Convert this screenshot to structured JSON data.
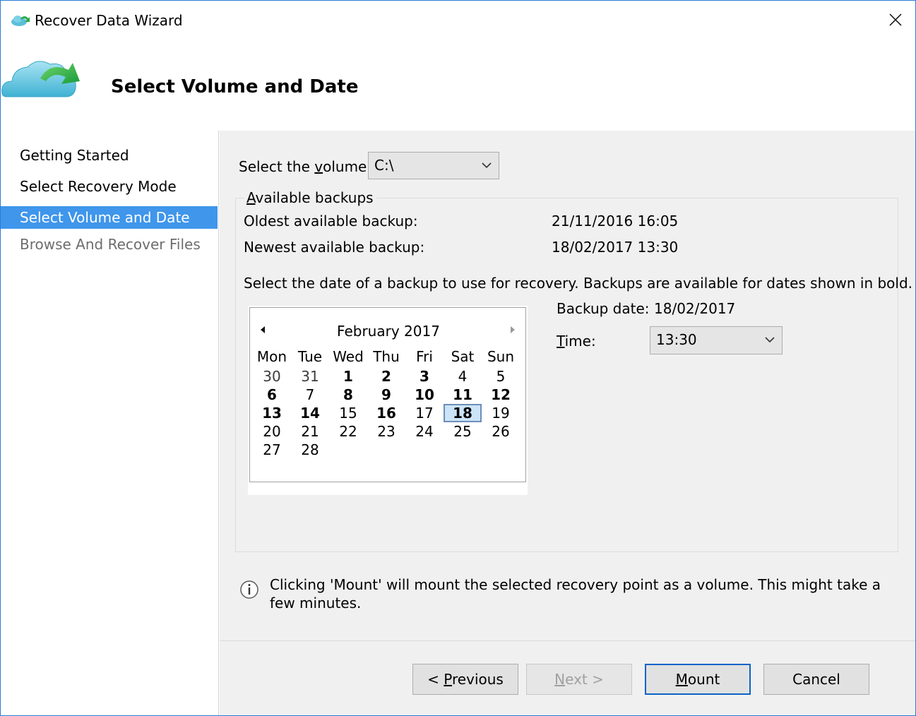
{
  "window": {
    "title": "Recover Data Wizard",
    "close_icon": "close-icon"
  },
  "header": {
    "title": "Select Volume and Date",
    "icon": "cloud-recovery-icon"
  },
  "nav": {
    "items": [
      {
        "label": "Getting Started",
        "state": "normal"
      },
      {
        "label": "Select Recovery Mode",
        "state": "normal"
      },
      {
        "label": "Select Volume and Date",
        "state": "active"
      },
      {
        "label": "Browse And Recover Files",
        "state": "disabled"
      }
    ]
  },
  "volume": {
    "label_pre": "Select the ",
    "label_accel": "v",
    "label_post": "olume:",
    "value": "C:\\"
  },
  "backups": {
    "group_accel": "A",
    "group_title": "vailable backups",
    "oldest_label": "Oldest available backup:",
    "oldest_value": "21/11/2016 16:05",
    "newest_label": "Newest available backup:",
    "newest_value": "18/02/2017 13:30",
    "instruction": "Select the date of a backup to use for recovery. Backups are available for dates shown in bold."
  },
  "calendar": {
    "month_label": "February 2017",
    "day_headers": [
      "Mon",
      "Tue",
      "Wed",
      "Thu",
      "Fri",
      "Sat",
      "Sun"
    ],
    "weeks": [
      [
        {
          "d": "30",
          "other": true
        },
        {
          "d": "31",
          "other": true
        },
        {
          "d": "1",
          "bold": true
        },
        {
          "d": "2",
          "bold": true
        },
        {
          "d": "3",
          "bold": true
        },
        {
          "d": "4"
        },
        {
          "d": "5"
        }
      ],
      [
        {
          "d": "6",
          "bold": true
        },
        {
          "d": "7"
        },
        {
          "d": "8",
          "bold": true
        },
        {
          "d": "9",
          "bold": true
        },
        {
          "d": "10",
          "bold": true
        },
        {
          "d": "11",
          "bold": true
        },
        {
          "d": "12",
          "bold": true
        }
      ],
      [
        {
          "d": "13",
          "bold": true
        },
        {
          "d": "14",
          "bold": true
        },
        {
          "d": "15"
        },
        {
          "d": "16",
          "bold": true
        },
        {
          "d": "17"
        },
        {
          "d": "18",
          "bold": true,
          "selected": true
        },
        {
          "d": "19"
        }
      ],
      [
        {
          "d": "20"
        },
        {
          "d": "21"
        },
        {
          "d": "22"
        },
        {
          "d": "23"
        },
        {
          "d": "24"
        },
        {
          "d": "25"
        },
        {
          "d": "26"
        }
      ],
      [
        {
          "d": "27"
        },
        {
          "d": "28"
        }
      ]
    ]
  },
  "backup_date": {
    "label": "Backup date:",
    "value": "18/02/2017"
  },
  "time": {
    "label_accel": "T",
    "label_post": "ime:",
    "value": "13:30"
  },
  "info": {
    "icon": "info-icon",
    "text": "Clicking 'Mount' will mount the selected recovery point as a volume. This might take a few minutes."
  },
  "buttons": {
    "previous_pre": "< ",
    "previous_accel": "P",
    "previous_post": "revious",
    "next_accel": "N",
    "next_post": "ext >",
    "mount_accel": "M",
    "mount_post": "ount",
    "cancel": "Cancel"
  },
  "colors": {
    "accent": "#3f96eb",
    "window_border": "#2b7bd6",
    "panel_bg": "#f0f0f0"
  }
}
